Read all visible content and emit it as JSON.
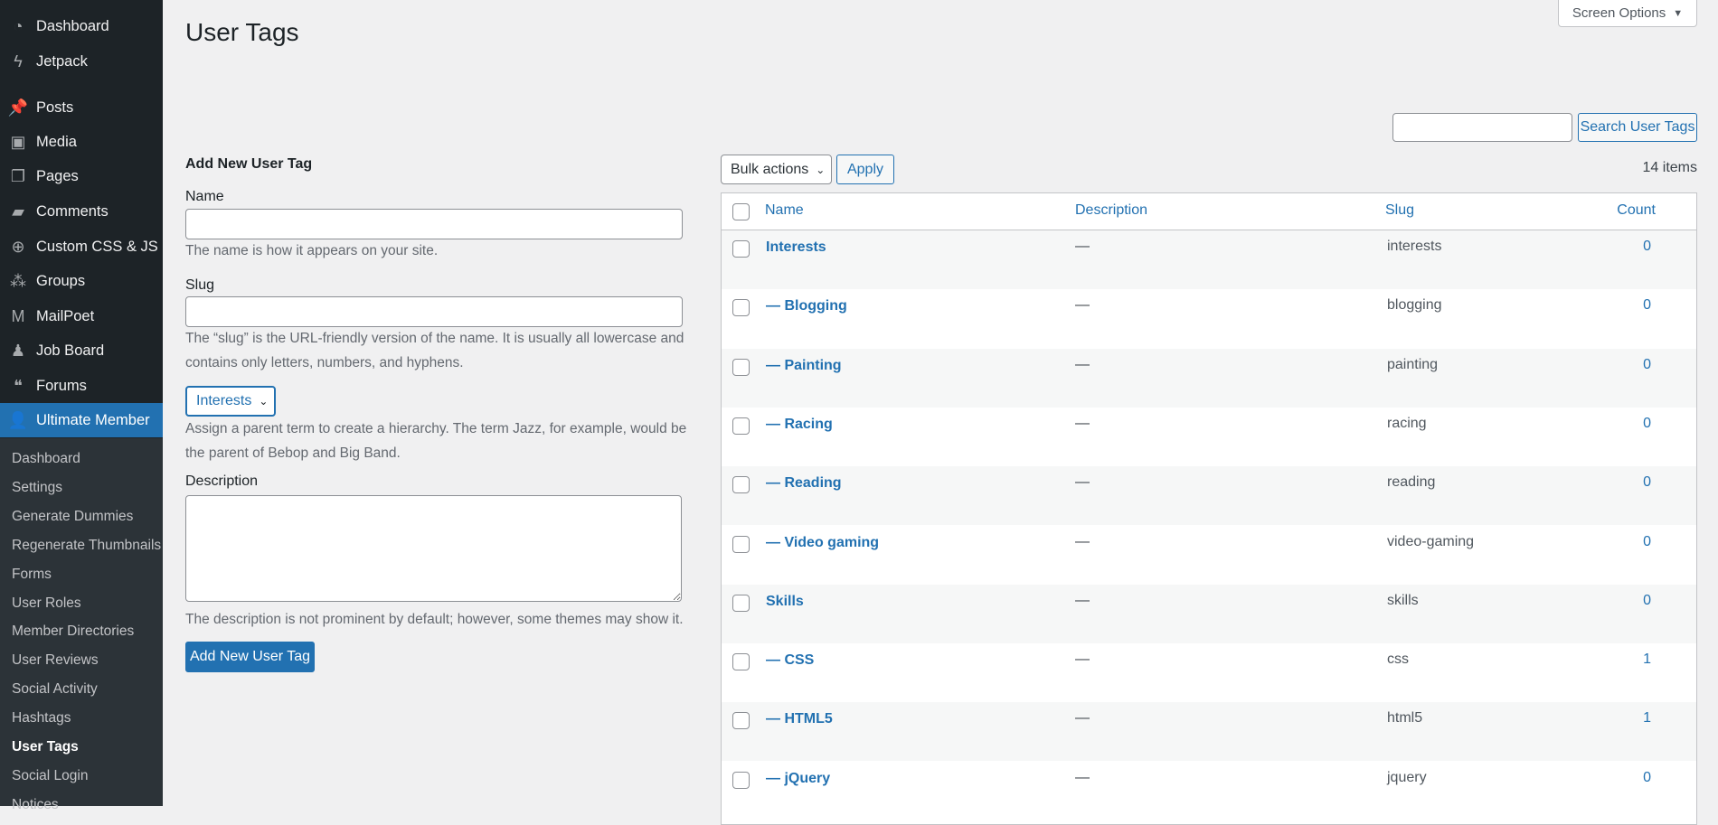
{
  "sidebar": {
    "menu": [
      {
        "label": "Dashboard",
        "icon": "dashboard-icon",
        "glyph": "◔"
      },
      {
        "label": "Jetpack",
        "icon": "jetpack-icon",
        "glyph": "ϟ"
      },
      {
        "label": "Posts",
        "icon": "pin-icon",
        "glyph": "📌"
      },
      {
        "label": "Media",
        "icon": "media-icon",
        "glyph": "▣"
      },
      {
        "label": "Pages",
        "icon": "pages-icon",
        "glyph": "❐"
      },
      {
        "label": "Comments",
        "icon": "comment-icon",
        "glyph": "▰"
      },
      {
        "label": "Custom CSS & JS",
        "icon": "plus-circle-icon",
        "glyph": "⊕"
      },
      {
        "label": "Groups",
        "icon": "groups-icon",
        "glyph": "⁂"
      },
      {
        "label": "MailPoet",
        "icon": "mailpoet-icon",
        "glyph": "M"
      },
      {
        "label": "Job Board",
        "icon": "person-icon",
        "glyph": "♟"
      },
      {
        "label": "Forums",
        "icon": "forums-icon",
        "glyph": "❝"
      },
      {
        "label": "Ultimate Member",
        "icon": "user-icon",
        "glyph": "👤"
      }
    ],
    "submenu": [
      "Dashboard",
      "Settings",
      "Generate Dummies",
      "Regenerate Thumbnails",
      "Forms",
      "User Roles",
      "Member Directories",
      "User Reviews",
      "Social Activity",
      "Hashtags",
      "User Tags",
      "Social Login",
      "Notices"
    ],
    "current_submenu": "User Tags"
  },
  "page_title": "User Tags",
  "screen_options": "Screen Options",
  "search": {
    "value": "",
    "button": "Search User Tags"
  },
  "form": {
    "heading": "Add New User Tag",
    "name_label": "Name",
    "name_value": "",
    "name_help": "The name is how it appears on your site.",
    "slug_label": "Slug",
    "slug_value": "",
    "slug_help": "The “slug” is the URL-friendly version of the name. It is usually all lowercase and contains only letters, numbers, and hyphens.",
    "parent_value": "Interests",
    "parent_help": "Assign a parent term to create a hierarchy. The term Jazz, for example, would be the parent of Bebop and Big Band.",
    "description_label": "Description",
    "description_value": "",
    "description_help": "The description is not prominent by default; however, some themes may show it.",
    "submit": "Add New User Tag"
  },
  "bulk": {
    "selected": "Bulk actions",
    "apply": "Apply",
    "items_count": "14 items"
  },
  "table": {
    "columns": {
      "name": "Name",
      "description": "Description",
      "slug": "Slug",
      "count": "Count"
    },
    "rows": [
      {
        "name": "Interests",
        "description": "—",
        "slug": "interests",
        "count": "0"
      },
      {
        "name": "— Blogging",
        "description": "—",
        "slug": "blogging",
        "count": "0"
      },
      {
        "name": "— Painting",
        "description": "—",
        "slug": "painting",
        "count": "0"
      },
      {
        "name": "— Racing",
        "description": "—",
        "slug": "racing",
        "count": "0"
      },
      {
        "name": "— Reading",
        "description": "—",
        "slug": "reading",
        "count": "0"
      },
      {
        "name": "— Video gaming",
        "description": "—",
        "slug": "video-gaming",
        "count": "0"
      },
      {
        "name": "Skills",
        "description": "—",
        "slug": "skills",
        "count": "0"
      },
      {
        "name": "— CSS",
        "description": "—",
        "slug": "css",
        "count": "1"
      },
      {
        "name": "— HTML5",
        "description": "—",
        "slug": "html5",
        "count": "1"
      },
      {
        "name": "— jQuery",
        "description": "—",
        "slug": "jquery",
        "count": "0"
      }
    ]
  }
}
